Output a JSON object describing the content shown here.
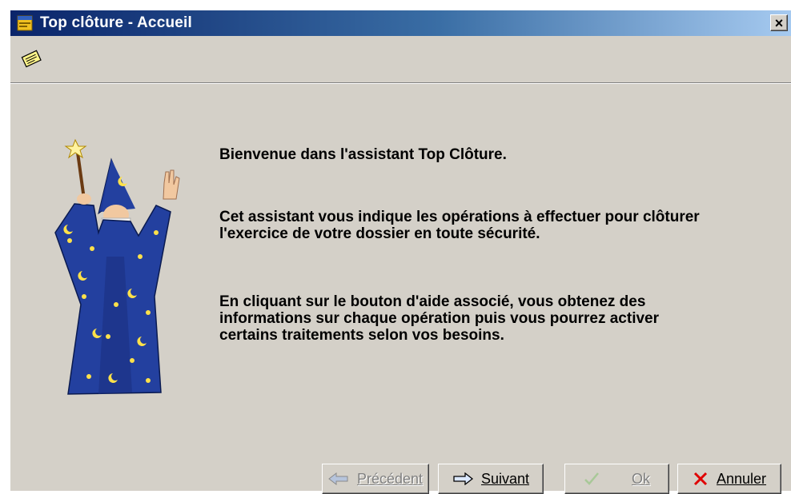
{
  "window": {
    "title": "Top clôture - Accueil",
    "close_label": "×"
  },
  "toolbar": {
    "icons": [
      "notes-icon"
    ]
  },
  "content": {
    "paragraph1": "Bienvenue dans l'assistant Top Clôture.",
    "paragraph2_line1": "Cet assistant vous indique les opérations à effectuer pour clôturer",
    "paragraph2_line2": "l'exercice de votre dossier en toute sécurité.",
    "paragraph3_line1": "En cliquant sur le bouton d'aide associé, vous obtenez des",
    "paragraph3_line2": "informations sur chaque opération puis vous pourrez activer",
    "paragraph3_line3": "certains traitements selon vos besoins."
  },
  "buttons": {
    "previous": {
      "label": "Précédent",
      "icon": "arrow-left-icon",
      "enabled": false
    },
    "next": {
      "label": "Suivant",
      "icon": "arrow-right-icon",
      "enabled": true
    },
    "ok": {
      "label": "Ok",
      "icon": "checkmark-icon",
      "enabled": false
    },
    "cancel": {
      "label": "Annuler",
      "icon": "cross-icon",
      "enabled": true
    }
  },
  "colors": {
    "titlebar_start": "#0a246a",
    "titlebar_end": "#a6caf0",
    "face": "#d4d0c8",
    "cancel_cross": "#e00000"
  }
}
